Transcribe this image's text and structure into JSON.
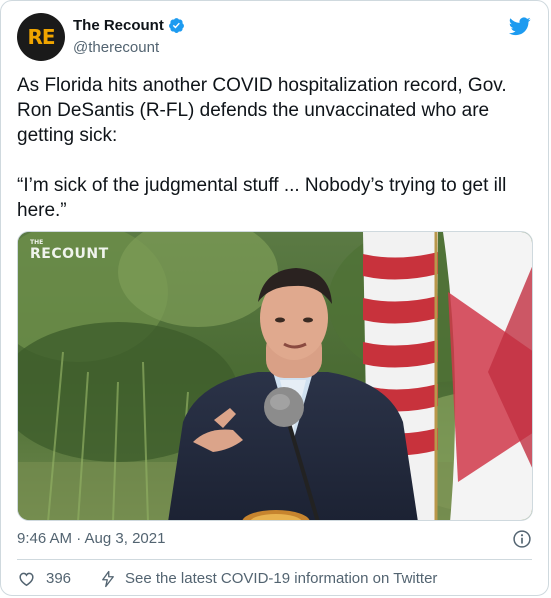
{
  "author": {
    "avatar_text": "RE",
    "display_name": "The Recount",
    "handle": "@therecount",
    "verified": true
  },
  "tweet": {
    "paragraph_1": "As Florida hits another COVID hospitalization record, Gov. Ron DeSantis (R-FL) defends the unvaccinated who are getting sick:",
    "paragraph_2": "“I’m sick of the judgmental stuff ... Nobody’s trying to get ill here.”"
  },
  "media": {
    "watermark_small": "THE",
    "watermark": "RECOUNT"
  },
  "meta": {
    "timestamp": "9:46 AM · Aug 3, 2021"
  },
  "actions": {
    "like_count": "396",
    "covid_info": "See the latest COVID-19 information on Twitter"
  },
  "colors": {
    "twitter_blue": "#1d9bf0",
    "text_primary": "#0f1419",
    "text_secondary": "#536471",
    "border": "#cfd9de"
  },
  "icons": [
    "verified-badge-icon",
    "twitter-bird-icon",
    "info-icon",
    "heart-icon",
    "lightning-icon"
  ]
}
